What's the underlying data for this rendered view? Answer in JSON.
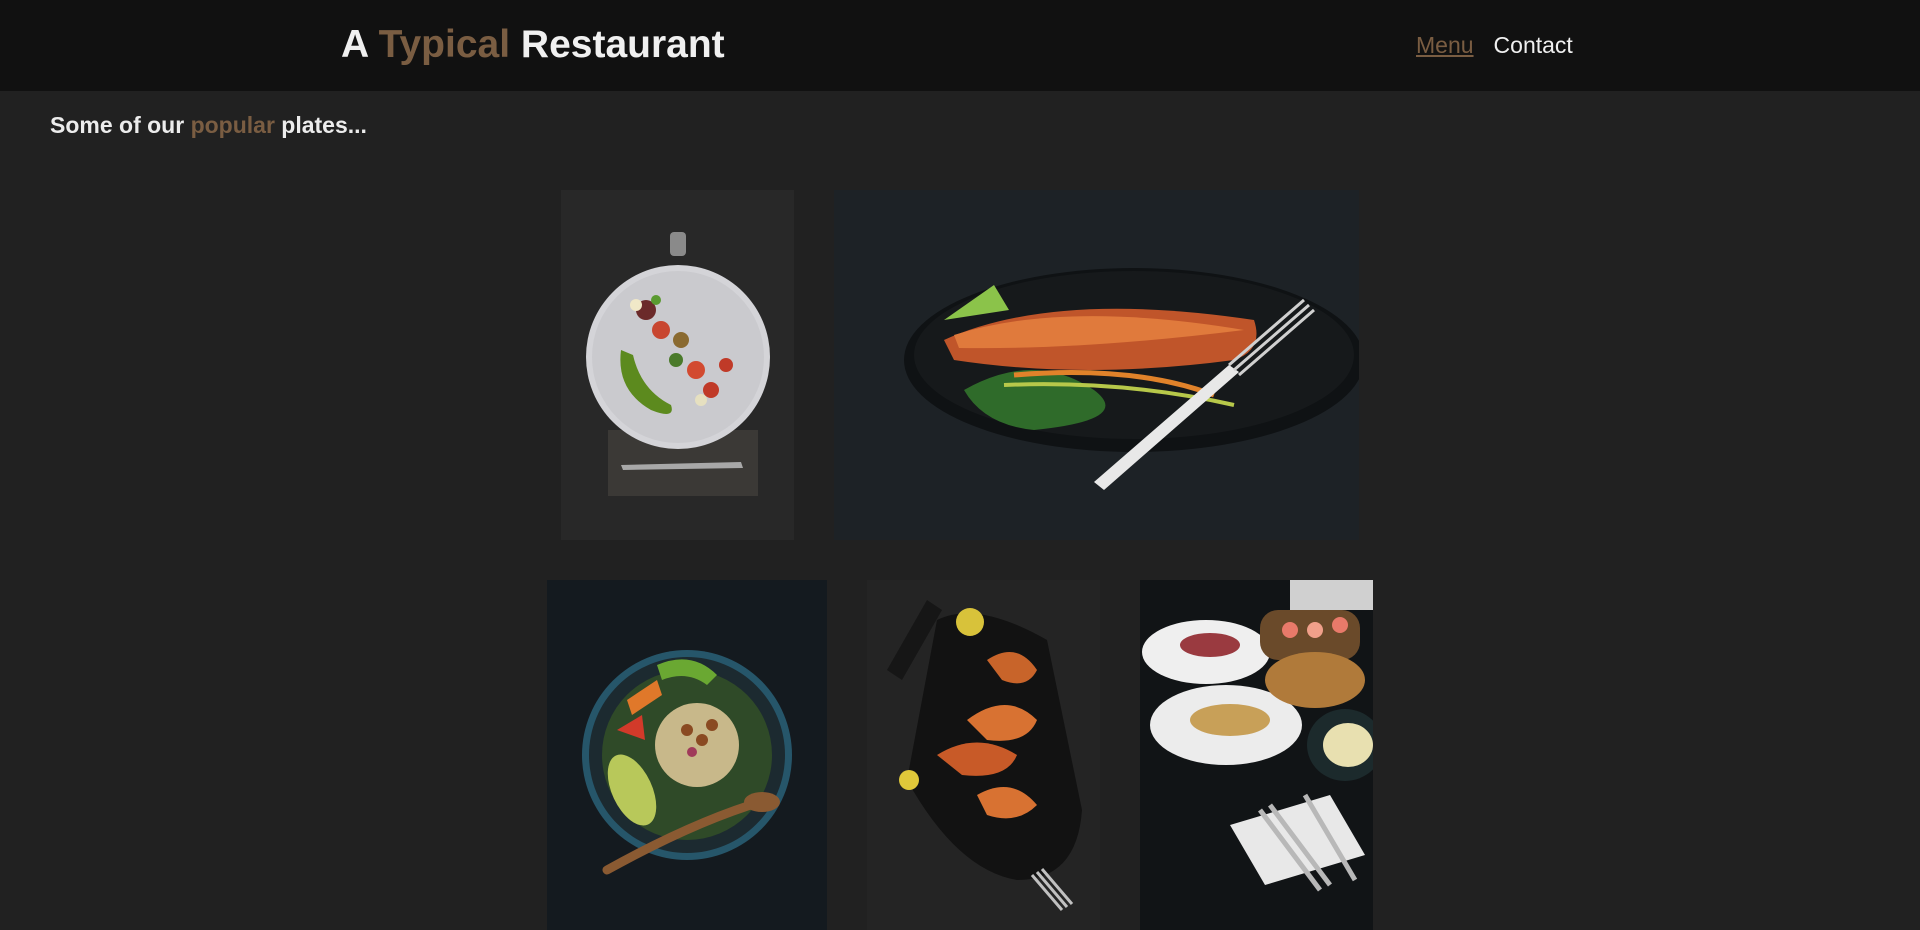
{
  "header": {
    "title_prefix": "A",
    "title_accent": "Typical",
    "title_suffix": "Restaurant",
    "nav": [
      {
        "label": "Menu",
        "active": true
      },
      {
        "label": "Contact",
        "active": false
      }
    ]
  },
  "intro": {
    "prefix": "Some of our",
    "accent": "popular",
    "suffix": "plates..."
  },
  "gallery": {
    "items": [
      {
        "name": "salad-plate-photo",
        "icon": "salad-plate"
      },
      {
        "name": "salmon-plate-photo",
        "icon": "salmon-plate"
      },
      {
        "name": "grain-bowl-photo",
        "icon": "grain-bowl"
      },
      {
        "name": "shrimp-platter-photo",
        "icon": "shrimp-platter"
      },
      {
        "name": "sushi-spread-photo",
        "icon": "sushi-spread"
      }
    ]
  },
  "colors": {
    "accent": "#7a5d42",
    "header_bg": "#111111",
    "page_bg": "#212121",
    "text": "#f0f0f0"
  }
}
